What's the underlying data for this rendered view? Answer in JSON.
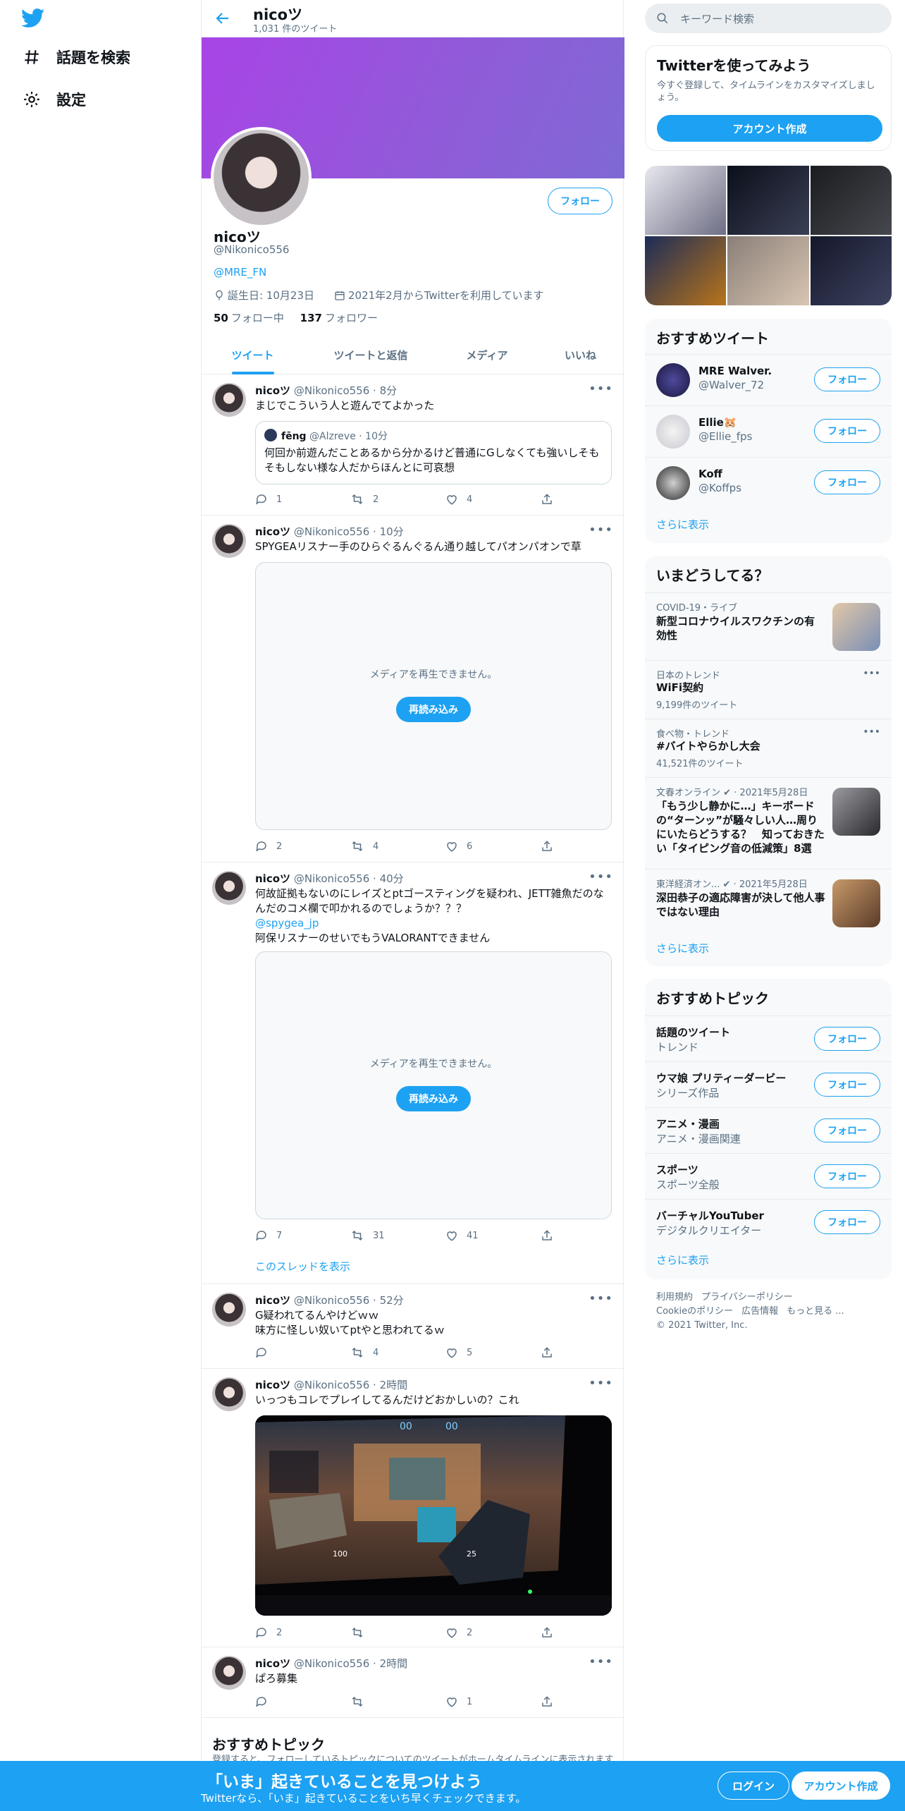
{
  "nav": {
    "search_label": "話題を検索",
    "settings_label": "設定"
  },
  "header": {
    "name": "nicoツ",
    "tweet_count": "1,031 件のツイート"
  },
  "profile": {
    "name": "nicoツ",
    "handle": "@Nikonico556",
    "link": "@MRE_FN",
    "birthday": "誕生日: 10月23日",
    "joined": "2021年2月からTwitterを利用しています",
    "following_count": "50",
    "following_label": "フォロー中",
    "followers_count": "137",
    "followers_label": "フォロワー",
    "follow_label": "フォロー"
  },
  "tabs": [
    "ツイート",
    "ツイートと返信",
    "メディア",
    "いいね"
  ],
  "tweets": [
    {
      "name": "nicoツ",
      "meta": "@Nikonico556 · 8分",
      "text": "まじでこういう人と遊んでてよかった",
      "quote": {
        "name": "fēng",
        "meta": "@Alzreve · 10分",
        "text": "何回か前遊んだことあるから分かるけど普通にGしなくても強いしそもそもしない様な人だからほんとに可哀想"
      },
      "replies": "1",
      "retweets": "2",
      "likes": "4"
    },
    {
      "name": "nicoツ",
      "meta": "@Nikonico556 · 10分",
      "text": "SPYGEAリスナー手のひらぐるんぐるん通り越してパオンパオンで草",
      "media_msg": "メディアを再生できません。",
      "reload": "再読み込み",
      "replies": "2",
      "retweets": "4",
      "likes": "6"
    },
    {
      "name": "nicoツ",
      "meta": "@Nikonico556 · 40分",
      "text": "何故証拠もないのにレイズとptゴースティングを疑われ、JETT雑魚だのなんだのコメ欄で叩かれるのでしょうか？？？",
      "mention": "@spygea_jp",
      "text2": "阿保リスナーのせいでもうVALORANTできません",
      "media_msg": "メディアを再生できません。",
      "reload": "再読み込み",
      "replies": "7",
      "retweets": "31",
      "likes": "41",
      "thread": "このスレッドを表示"
    },
    {
      "name": "nicoツ",
      "meta": "@Nikonico556 · 52分",
      "text": "G疑われてるんやけどｗｗ",
      "text2": "味方に怪しい奴いてptやと思われてるｗ",
      "replies": "",
      "retweets": "4",
      "likes": "5"
    },
    {
      "name": "nicoツ",
      "meta": "@Nikonico556 · 2時間",
      "text": "いっつもコレでプレイしてるんだけどおかしいの？これ",
      "hud_score_a": "00",
      "hud_score_b": "00",
      "hud_health": "100",
      "hud_ammo": "25",
      "replies": "2",
      "retweets": "",
      "likes": "2"
    },
    {
      "name": "nicoツ",
      "meta": "@Nikonico556 · 2時間",
      "text": "ぱろ募集",
      "replies": "",
      "retweets": "",
      "likes": "1"
    }
  ],
  "main_topics": {
    "title": "おすすめトピック",
    "desc": "登録すると、フォローしているトピックについてのツイートがホームタイムラインに表示されます"
  },
  "sidebar": {
    "search_placeholder": "キーワード検索",
    "join": {
      "title": "Twitterを使ってみよう",
      "desc": "今すぐ登録して、タイムラインをカスタマイズしましょう。",
      "button": "アカウント作成"
    },
    "recommended": {
      "title": "おすすめツイート",
      "follow": "フォロー",
      "more": "さらに表示",
      "users": [
        {
          "name": "MRE Walver.",
          "handle": "@Walver_72"
        },
        {
          "name": "Ellie🐹",
          "handle": "@Ellie_fps"
        },
        {
          "name": "Koff",
          "handle": "@Koffps"
        }
      ]
    },
    "trends": {
      "title": "いまどうしてる？",
      "more": "さらに表示",
      "items": [
        {
          "cat": "COVID-19・ライブ",
          "title": "新型コロナウイルスワクチンの有効性",
          "count": ""
        },
        {
          "cat": "日本のトレンド",
          "title": "WiFi契約",
          "count": "9,199件のツイート"
        },
        {
          "cat": "食べ物・トレンド",
          "title": "#バイトやらかし大会",
          "count": "41,521件のツイート"
        },
        {
          "cat": "文春オンライン ✔ · 2021年5月28日",
          "title": "「もう少し静かに…」キーボードの“ターンッ”が騒々しい人…周りにいたらどうする？　知っておきたい「タイピング音の低減策」8選",
          "count": ""
        },
        {
          "cat": "東洋経済オン... ✔ · 2021年5月28日",
          "title": "深田恭子の適応障害が決して他人事ではない理由",
          "count": ""
        }
      ]
    },
    "topics": {
      "title": "おすすめトピック",
      "follow": "フォロー",
      "more": "さらに表示",
      "items": [
        {
          "name": "話題のツイート",
          "sub": "トレンド"
        },
        {
          "name": "ウマ娘 プリティーダービー",
          "sub": "シリーズ作品"
        },
        {
          "name": "アニメ・漫画",
          "sub": "アニメ・漫画関連"
        },
        {
          "name": "スポーツ",
          "sub": "スポーツ全般"
        },
        {
          "name": "バーチャルYouTuber",
          "sub": "デジタルクリエイター"
        }
      ]
    },
    "footer": {
      "terms": "利用規約",
      "privacy": "プライバシーポリシー",
      "cookie": "Cookieのポリシー",
      "ads": "広告情報",
      "more": "もっと見る ...",
      "copyright": "© 2021 Twitter, Inc."
    }
  },
  "bottom_bar": {
    "title": "「いま」起きていることを見つけよう",
    "subtitle": "Twitterなら、「いま」起きていることをいち早くチェックできます。",
    "login": "ログイン",
    "signup": "アカウント作成"
  },
  "colors": {
    "accent": "#1da1f2",
    "banner_start": "#a844e6",
    "banner_end": "#7f69d4"
  }
}
